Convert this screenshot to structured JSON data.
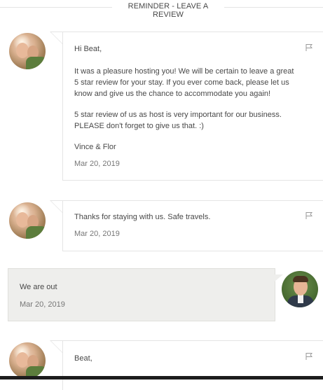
{
  "section_divider": {
    "label": "REMINDER - LEAVE A REVIEW"
  },
  "messages": [
    {
      "paragraphs": [
        "Hi Beat,",
        "It was a pleasure hosting you! We will be certain to leave a great 5 star review for your stay. If you ever come back, please let us know and give us the chance to accommodate you again!",
        "5 star review of us as host is very important for our business. PLEASE don't forget to give us that. :)",
        "Vince & Flor"
      ],
      "date": "Mar 20, 2019"
    },
    {
      "paragraphs": [
        "Thanks for staying with us.  Safe travels."
      ],
      "date": "Mar 20, 2019"
    },
    {
      "paragraphs": [
        "Beat,"
      ],
      "date": ""
    }
  ],
  "own_message": {
    "text": "We are out",
    "date": "Mar 20, 2019"
  },
  "icons": {
    "flag": "flag-icon",
    "host_avatar": "host-avatar",
    "guest_avatar": "guest-avatar"
  },
  "colors": {
    "text": "#484848",
    "muted": "#767676",
    "border": "#e4e4e4",
    "own_bubble_bg": "#eeeeec"
  }
}
